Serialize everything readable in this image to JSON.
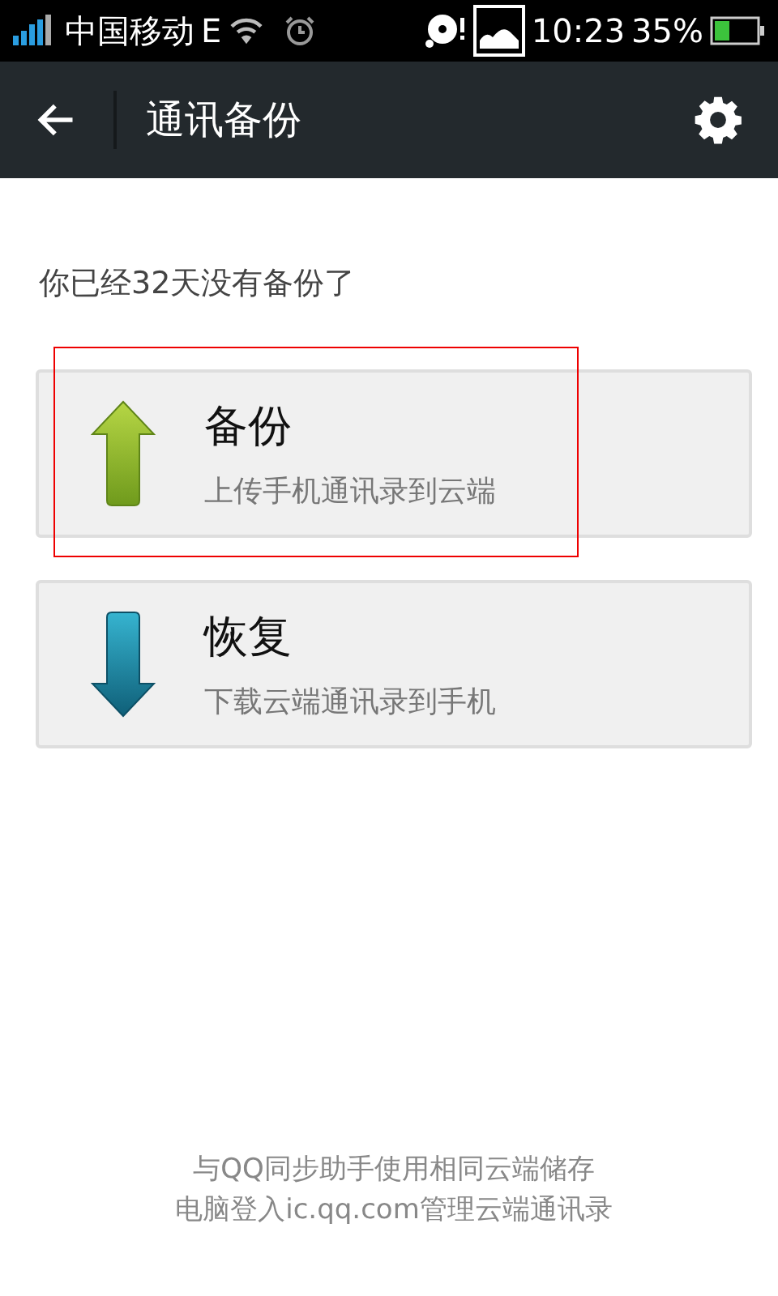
{
  "status_bar": {
    "carrier": "中国移动",
    "network": "E",
    "time": "10:23",
    "battery": "35%"
  },
  "header": {
    "title": "通讯备份"
  },
  "notice": "你已经32天没有备份了",
  "actions": [
    {
      "kind": "upload",
      "title": "备份",
      "subtitle": "上传手机通讯录到云端",
      "highlighted": true
    },
    {
      "kind": "download",
      "title": "恢复",
      "subtitle": "下载云端通讯录到手机",
      "highlighted": false
    }
  ],
  "footer": [
    "与QQ同步助手使用相同云端储存",
    "电脑登入ic.qq.com管理云端通讯录"
  ]
}
